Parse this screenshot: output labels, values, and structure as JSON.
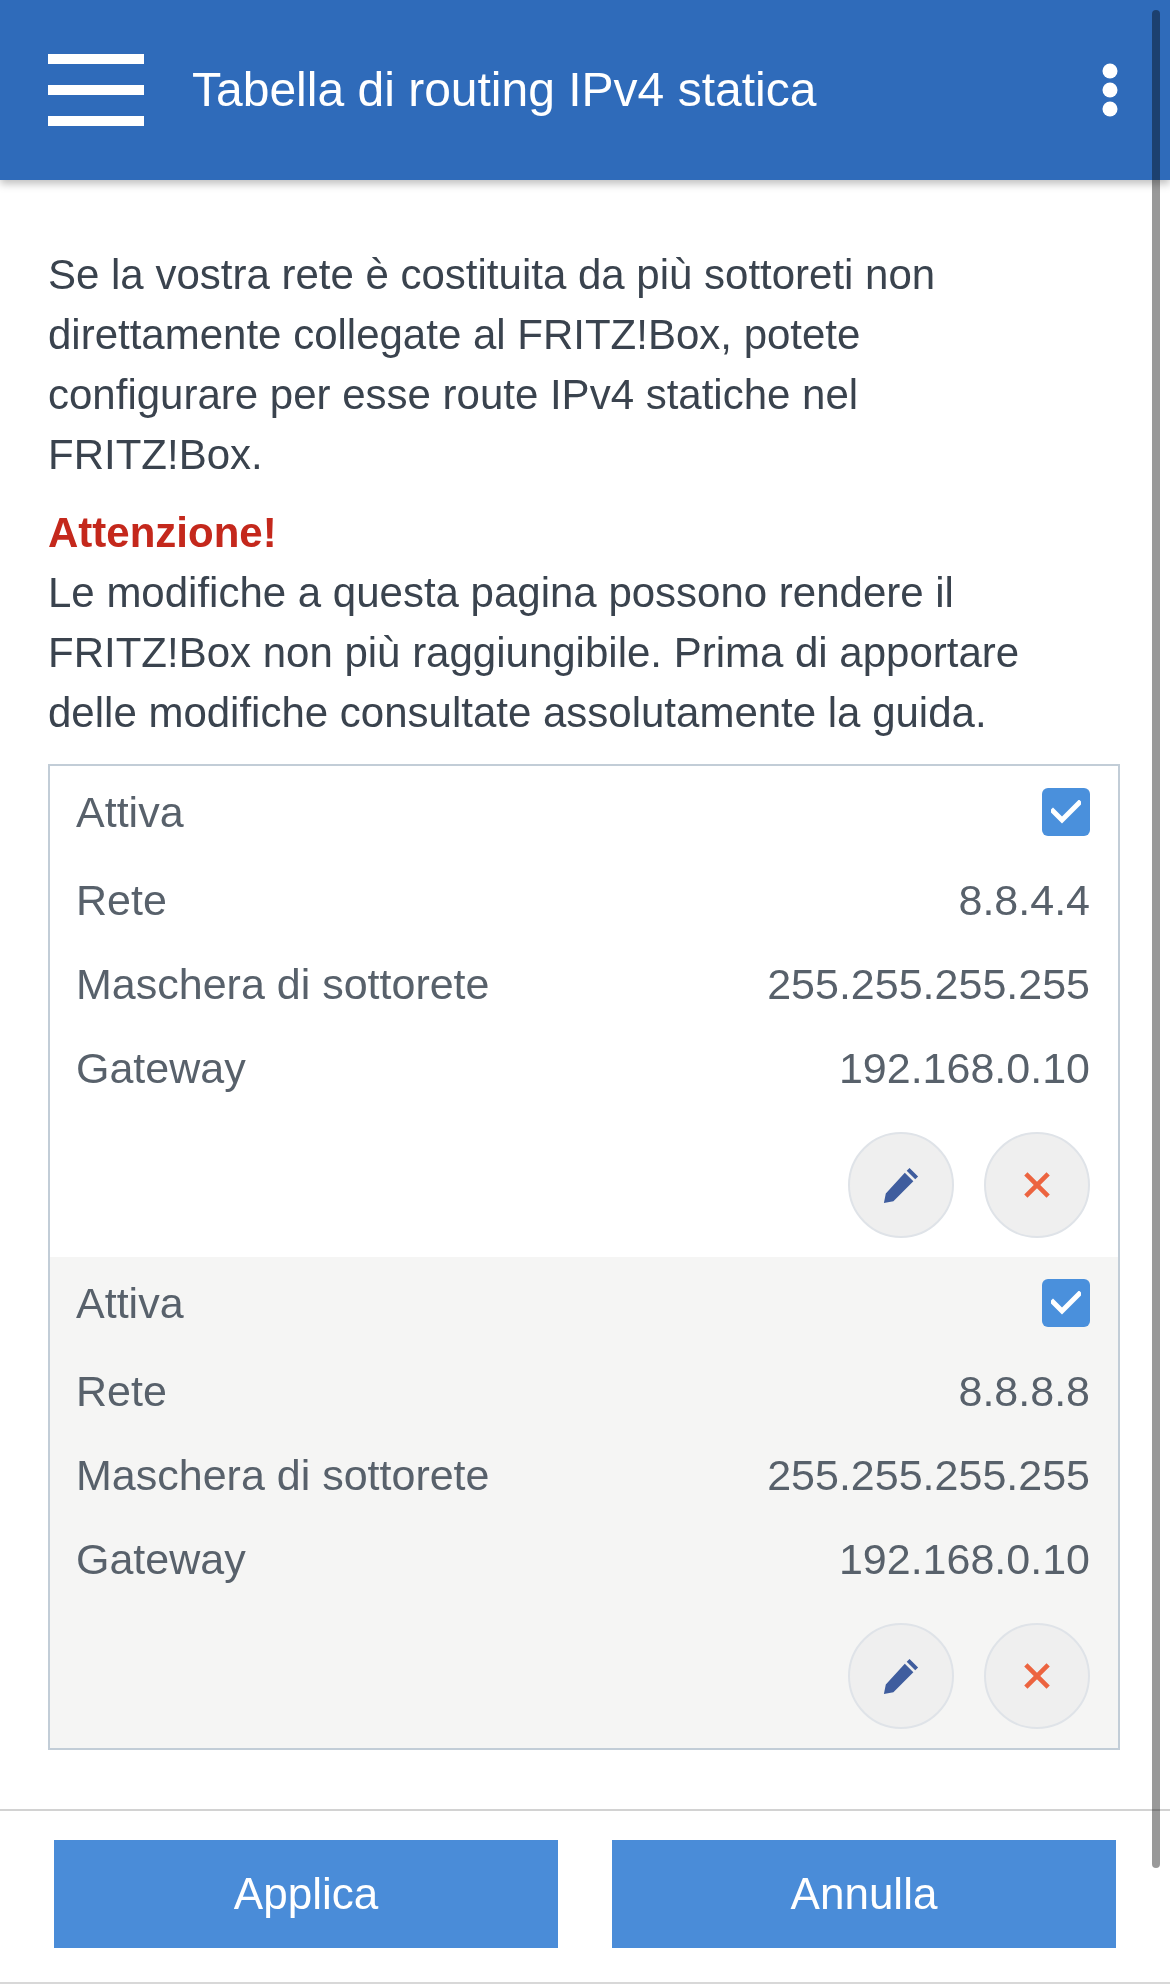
{
  "app_bar": {
    "title": "Tabella di routing IPv4 statica"
  },
  "intro": "Se la vostra rete è costituita da più sottoreti non direttamente collegate al FRITZ!Box, potete configurare per esse route IPv4 statiche nel FRITZ!Box.",
  "warning": {
    "title": "Attenzione!",
    "text": "Le modifiche a questa pagina possono rendere il FRITZ!Box non più raggiungibile. Prima di apportare delle modifiche consultate assolutamente la guida."
  },
  "routes": [
    {
      "active_label": "Attiva",
      "checked": true,
      "fields": [
        {
          "label": "Rete",
          "value": "8.8.4.4"
        },
        {
          "label": "Maschera di sottorete",
          "value": "255.255.255.255"
        },
        {
          "label": "Gateway",
          "value": "192.168.0.10"
        }
      ]
    },
    {
      "active_label": "Attiva",
      "checked": true,
      "fields": [
        {
          "label": "Rete",
          "value": "8.8.8.8"
        },
        {
          "label": "Maschera di sottorete",
          "value": "255.255.255.255"
        },
        {
          "label": "Gateway",
          "value": "192.168.0.10"
        }
      ]
    }
  ],
  "buttons": [
    {
      "label": "Applica"
    },
    {
      "label": "Annulla"
    }
  ]
}
